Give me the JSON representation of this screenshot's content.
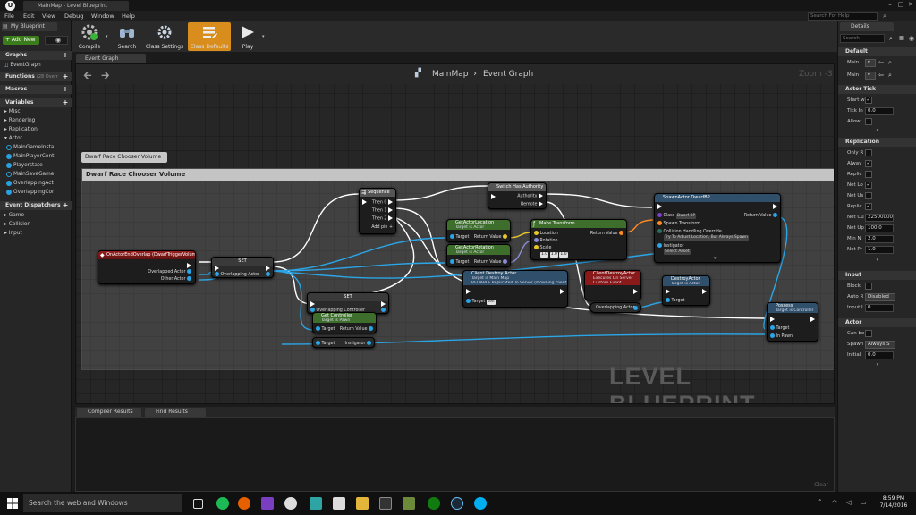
{
  "window": {
    "tab_title": "MainMap - Level Blueprint",
    "logo": "U"
  },
  "menu": [
    "File",
    "Edit",
    "View",
    "Debug",
    "Window",
    "Help"
  ],
  "help_search_placeholder": "Search For Help",
  "left_panel": {
    "tab": "My Blueprint",
    "add_new": "+ Add New",
    "sections": {
      "graphs": "Graphs",
      "functions": "Functions",
      "functions_count": "(28 Overr",
      "macros": "Macros",
      "variables": "Variables",
      "dispatchers": "Event Dispatchers"
    },
    "graph_items": [
      "EventGraph"
    ],
    "variable_categories": [
      "Misc",
      "Rendering",
      "Replication",
      "Actor"
    ],
    "variables": [
      "MainGameInsta",
      "MainPlayerCont",
      "Playerstate",
      "MainSaveGame",
      "OverlappingAct",
      "OverlappingCor"
    ],
    "dispatcher_categories": [
      "Game",
      "Collision",
      "Input"
    ]
  },
  "toolbar": {
    "compile": "Compile",
    "search": "Search",
    "class_settings": "Class Settings",
    "class_defaults": "Class Defaults",
    "play": "Play"
  },
  "graph": {
    "tab": "Event Graph",
    "crumb_map": "MainMap",
    "crumb_sep": "›",
    "crumb_graph": "Event Graph",
    "zoom": "Zoom -3",
    "watermark": "LEVEL BLUEPRINT",
    "comment_bubble": "Dwarf Race Chooser Volume",
    "comment_title": "Dwarf Race Chooser Volume"
  },
  "nodes": {
    "end_overlap": {
      "title": "OnActorEndOverlap (DwarfTriggerVolume)",
      "pin1": "Overlapped Actor",
      "pin2": "Other Actor"
    },
    "set1": {
      "title": "SET",
      "pin": "Overlapping Actor"
    },
    "sequence": {
      "title": "Sequence",
      "then0": "Then 0",
      "then1": "Then 1",
      "then2": "Then 2",
      "add": "Add pin"
    },
    "switch_auth": {
      "title": "Switch Has Authority",
      "authority": "Authority",
      "remote": "Remote"
    },
    "get_loc": {
      "title": "GetActorLocation",
      "sub": "Target is Actor",
      "target": "Target",
      "ret": "Return Value"
    },
    "get_rot": {
      "title": "GetActorRotation",
      "sub": "Target is Actor",
      "target": "Target",
      "ret": "Return Value"
    },
    "make_transform": {
      "title": "Make Transform",
      "location": "Location",
      "rotation": "Rotation",
      "scale": "Scale",
      "ret": "Return Value",
      "sx": "1.0",
      "sy": "1.0",
      "sz": "1.0"
    },
    "spawn": {
      "title": "SpawnActor DwarfBP",
      "cls": "Class",
      "cls_val": "Dwarf BP",
      "spawn_transform": "Spawn Transform",
      "collision": "Collision Handling Override",
      "collision_val": "Try To Adjust Location, But Always Spawn",
      "instigator": "Instigator",
      "instigator_val": "Select Asset",
      "ret": "Return Value"
    },
    "client_destroy": {
      "title": "Client Destroy Actor",
      "sub1": "Target is Main Map",
      "sub2": "RELIABLE Replicated To Server (if owning client)",
      "target": "Target",
      "target_val": "self"
    },
    "client_event": {
      "title": "ClientDestroyActor",
      "sub1": "Executes On Server",
      "sub2": "Custom Event",
      "pin": "Overlapping Actor"
    },
    "destroy": {
      "title": "DestroyActor",
      "sub": "Target is Actor",
      "target": "Target"
    },
    "set2": {
      "title": "SET",
      "pin": "Overlapping Controller"
    },
    "get_controller": {
      "title": "Get Controller",
      "sub": "Target is Pawn",
      "target": "Target",
      "ret": "Return Value"
    },
    "get_instigator": {
      "target": "Target",
      "instigator": "Instigator"
    },
    "possess": {
      "title": "Possess",
      "sub": "Target is Controller",
      "target": "Target",
      "in_pawn": "In Pawn"
    }
  },
  "bottom": {
    "tab1": "Compiler Results",
    "tab2": "Find Results",
    "clear": "Clear"
  },
  "details": {
    "tab": "Details",
    "search_placeholder": "Search",
    "sections": [
      "Default",
      "Actor Tick",
      "Replication",
      "Input",
      "Actor"
    ],
    "default_rows": [
      {
        "label": "Main I"
      },
      {
        "label": "Main I"
      }
    ],
    "actor_tick": [
      {
        "label": "Start w",
        "type": "check",
        "value": "✓"
      },
      {
        "label": "Tick In",
        "type": "field",
        "value": "0.0"
      },
      {
        "label": "Allow",
        "type": "check",
        "value": ""
      }
    ],
    "replication": [
      {
        "label": "Only R",
        "type": "check",
        "value": ""
      },
      {
        "label": "Alway",
        "type": "check",
        "value": "✓"
      },
      {
        "label": "Replic",
        "type": "check",
        "value": ""
      },
      {
        "label": "Net Lo",
        "type": "check",
        "value": "✓"
      },
      {
        "label": "Net Us",
        "type": "check",
        "value": ""
      },
      {
        "label": "Replic",
        "type": "check",
        "value": "✓"
      },
      {
        "label": "Net Cu",
        "type": "field",
        "value": "22500000"
      },
      {
        "label": "Net Up",
        "type": "field",
        "value": "100.0"
      },
      {
        "label": "Min N",
        "type": "field",
        "value": "2.0"
      },
      {
        "label": "Net Pr",
        "type": "field",
        "value": "1.0"
      }
    ],
    "input": [
      {
        "label": "Block",
        "type": "check",
        "value": ""
      },
      {
        "label": "Auto R",
        "type": "drop",
        "value": "Disabled"
      },
      {
        "label": "Input I",
        "type": "field",
        "value": "0"
      }
    ],
    "actor": [
      {
        "label": "Can be",
        "type": "check",
        "value": ""
      },
      {
        "label": "Spawn",
        "type": "drop",
        "value": "Always S"
      },
      {
        "label": "Initial",
        "type": "field",
        "value": "0.0"
      }
    ]
  },
  "taskbar": {
    "search": "Search the web and Windows",
    "time": "8:59 PM",
    "date": "7/14/2016"
  },
  "colors": {
    "accent": "#e5a023",
    "exec": "#ffffff",
    "object_pin": "#2aa5e6",
    "pure_node": "#3d6e2c",
    "event_node": "#8a1a1a",
    "function_node": "#2f4f6a"
  }
}
